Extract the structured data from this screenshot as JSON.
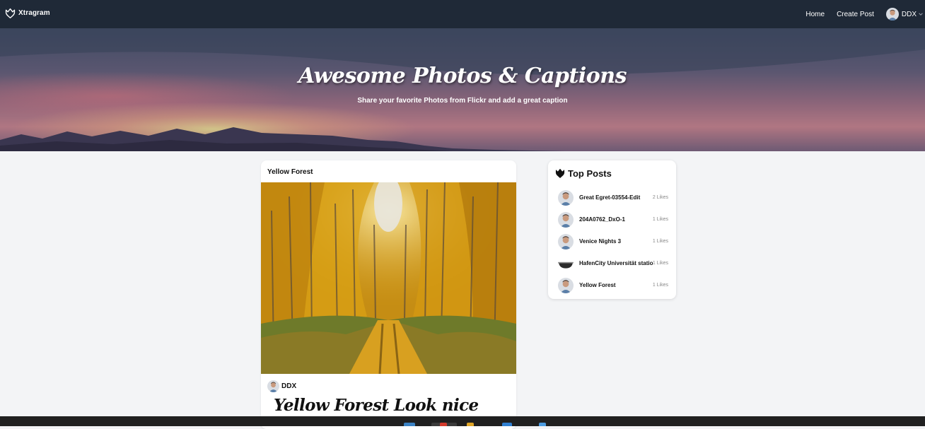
{
  "nav": {
    "brand": "Xtragram",
    "links": {
      "home": "Home",
      "create_post": "Create Post"
    },
    "user": "DDX"
  },
  "hero": {
    "title": "Awesome Photos & Captions",
    "subtitle": "Share your favorite Photos from Flickr and add a great caption"
  },
  "post": {
    "title": "Yellow Forest",
    "author": "DDX",
    "caption": "Yellow Forest Look nice"
  },
  "top_posts": {
    "title": "Top Posts",
    "items": [
      {
        "title": "Great Egret-03554-Edit",
        "likes": "2 Likes",
        "thumb": "avatar"
      },
      {
        "title": "204A0762_DxO-1",
        "likes": "1 Likes",
        "thumb": "avatar"
      },
      {
        "title": "Venice Nights 3",
        "likes": "1 Likes",
        "thumb": "avatar"
      },
      {
        "title": "HafenCity Universität station",
        "likes": "1 Likes",
        "thumb": "bowl"
      },
      {
        "title": "Yellow Forest",
        "likes": "1 Likes",
        "thumb": "avatar"
      }
    ]
  },
  "icons": {
    "brand": "heart-crown-icon",
    "user_menu": "chevron-down-icon",
    "top_posts": "heart-crown-icon"
  },
  "colors": {
    "navbar": "#1f2937",
    "page_background": "#f3f4f6",
    "card": "#ffffff",
    "taskbar": "#202020"
  }
}
